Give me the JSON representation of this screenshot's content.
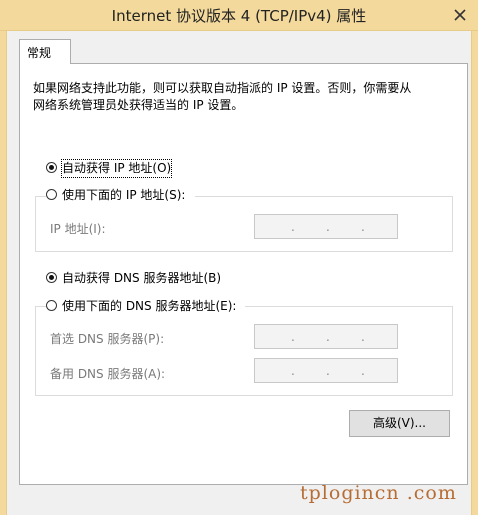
{
  "window": {
    "title": "Internet 协议版本 4 (TCP/IPv4) 属性",
    "close_glyph": "✕"
  },
  "tabs": [
    {
      "label": "常规",
      "active": true
    }
  ],
  "description": {
    "line1": "如果网络支持此功能，则可以获取自动指派的 IP 设置。否则，你需要从",
    "line2": "网络系统管理员处获得适当的 IP 设置。"
  },
  "ip_section": {
    "auto_option": {
      "label": "自动获得 IP 地址(O)",
      "checked": true
    },
    "manual_option": {
      "label": "使用下面的 IP 地址(S):",
      "checked": false
    },
    "fields": [
      {
        "label": "IP 地址(I):",
        "value": ". . ."
      }
    ]
  },
  "dns_section": {
    "auto_option": {
      "label": "自动获得 DNS 服务器地址(B)",
      "checked": true
    },
    "manual_option": {
      "label": "使用下面的 DNS 服务器地址(E):",
      "checked": false
    },
    "fields": [
      {
        "label": "首选 DNS 服务器(P):",
        "value": ". . ."
      },
      {
        "label": "备用 DNS 服务器(A):",
        "value": ". . ."
      }
    ]
  },
  "advanced_button": {
    "label": "高级(V)..."
  },
  "watermark": "tplogincn .com",
  "colors": {
    "title_bar": "#f3d99c",
    "dialog_background": "#f0f0f0",
    "panel_background": "#ffffff",
    "watermark": "#b56d35"
  }
}
